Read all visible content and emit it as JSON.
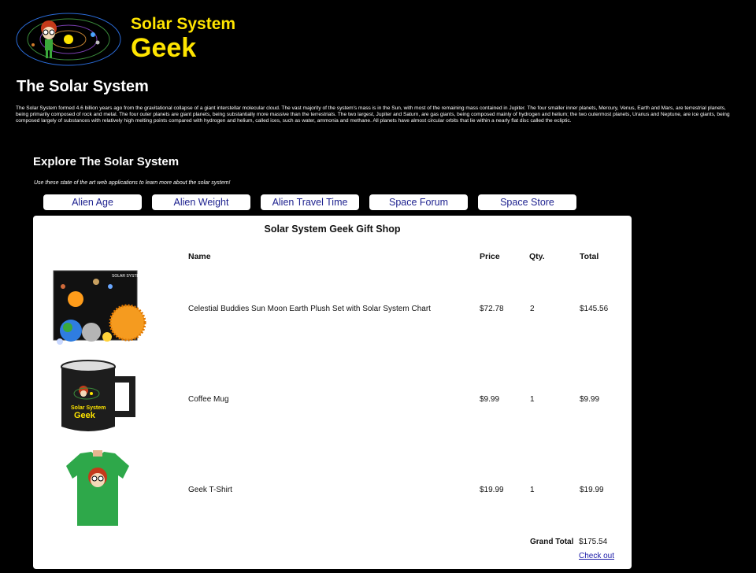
{
  "brand": {
    "line1": "Solar System",
    "line2": "Geek",
    "color": "#ffe500"
  },
  "page": {
    "title": "The Solar System",
    "intro": "The Solar System formed 4.6 billion years ago from the gravitational collapse of a giant interstellar molecular cloud. The vast majority of the system's mass is in the Sun, with most of the remaining mass contained in Jupiter. The four smaller inner planets, Mercury, Venus, Earth and Mars, are terrestrial planets, being primarily composed of rock and metal. The four outer planets are giant planets, being substantially more massive than the terrestrials. The two largest, Jupiter and Saturn, are gas giants, being composed mainly of hydrogen and helium; the two outermost planets, Uranus and Neptune, are ice giants, being composed largely of substances with relatively high melting points compared with hydrogen and helium, called ices, such as water, ammonia and methane. All planets have almost circular orbits that lie within a nearly flat disc called the ecliptic."
  },
  "explore": {
    "title": "Explore The Solar System",
    "subtitle": "Use these state of the art web applications to learn more about the solar system!"
  },
  "nav": [
    "Alien Age",
    "Alien Weight",
    "Alien Travel Time",
    "Space Forum",
    "Space Store"
  ],
  "shop": {
    "title": "Solar System Geek Gift Shop",
    "headers": {
      "name": "Name",
      "price": "Price",
      "qty": "Qty.",
      "total": "Total"
    },
    "items": [
      {
        "name": "Celestial Buddies Sun Moon Earth Plush Set with Solar System Chart",
        "price": "$72.78",
        "qty": "2",
        "total": "$145.56",
        "image": "plush-set-image"
      },
      {
        "name": "Coffee Mug",
        "price": "$9.99",
        "qty": "1",
        "total": "$9.99",
        "image": "mug-image"
      },
      {
        "name": "Geek T-Shirt",
        "price": "$19.99",
        "qty": "1",
        "total": "$19.99",
        "image": "tshirt-image"
      }
    ],
    "grand_total_label": "Grand Total",
    "grand_total": "$175.54",
    "checkout_label": "Check out",
    "mug_brand_line1": "Solar System",
    "mug_brand_line2": "Geek"
  }
}
